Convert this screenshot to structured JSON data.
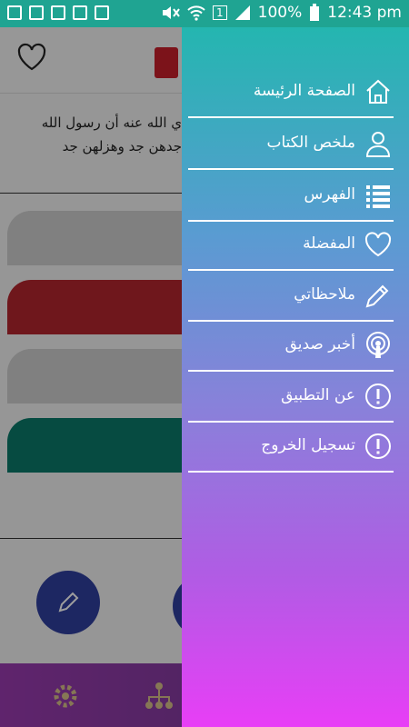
{
  "status_bar": {
    "battery": "100%",
    "time": "12:43 pm",
    "sim": "1"
  },
  "page": {
    "quote_line1": "ي الله عنه أن رسول الله",
    "quote_line2": "جدهن جد وهزلهن جد"
  },
  "drawer": {
    "items": [
      {
        "label": "الصفحة الرئيسة",
        "icon": "home-icon"
      },
      {
        "label": "ملخص الكتاب",
        "icon": "user-icon"
      },
      {
        "label": "الفهرس",
        "icon": "list-icon"
      },
      {
        "label": "المفضلة",
        "icon": "heart-icon"
      },
      {
        "label": "ملاحظاتي",
        "icon": "pencil-icon"
      },
      {
        "label": "أخبر صديق",
        "icon": "broadcast-icon"
      },
      {
        "label": "عن التطبيق",
        "icon": "info-icon"
      },
      {
        "label": "تسجيل الخروج",
        "icon": "exit-info-icon"
      }
    ]
  },
  "colors": {
    "status_bar": "#1fa492",
    "drawer_top": "#24b6b0",
    "drawer_bottom": "#e83ef6",
    "card_red": "#b3262e",
    "card_teal": "#0b7a6a",
    "fab": "#303f9f"
  }
}
